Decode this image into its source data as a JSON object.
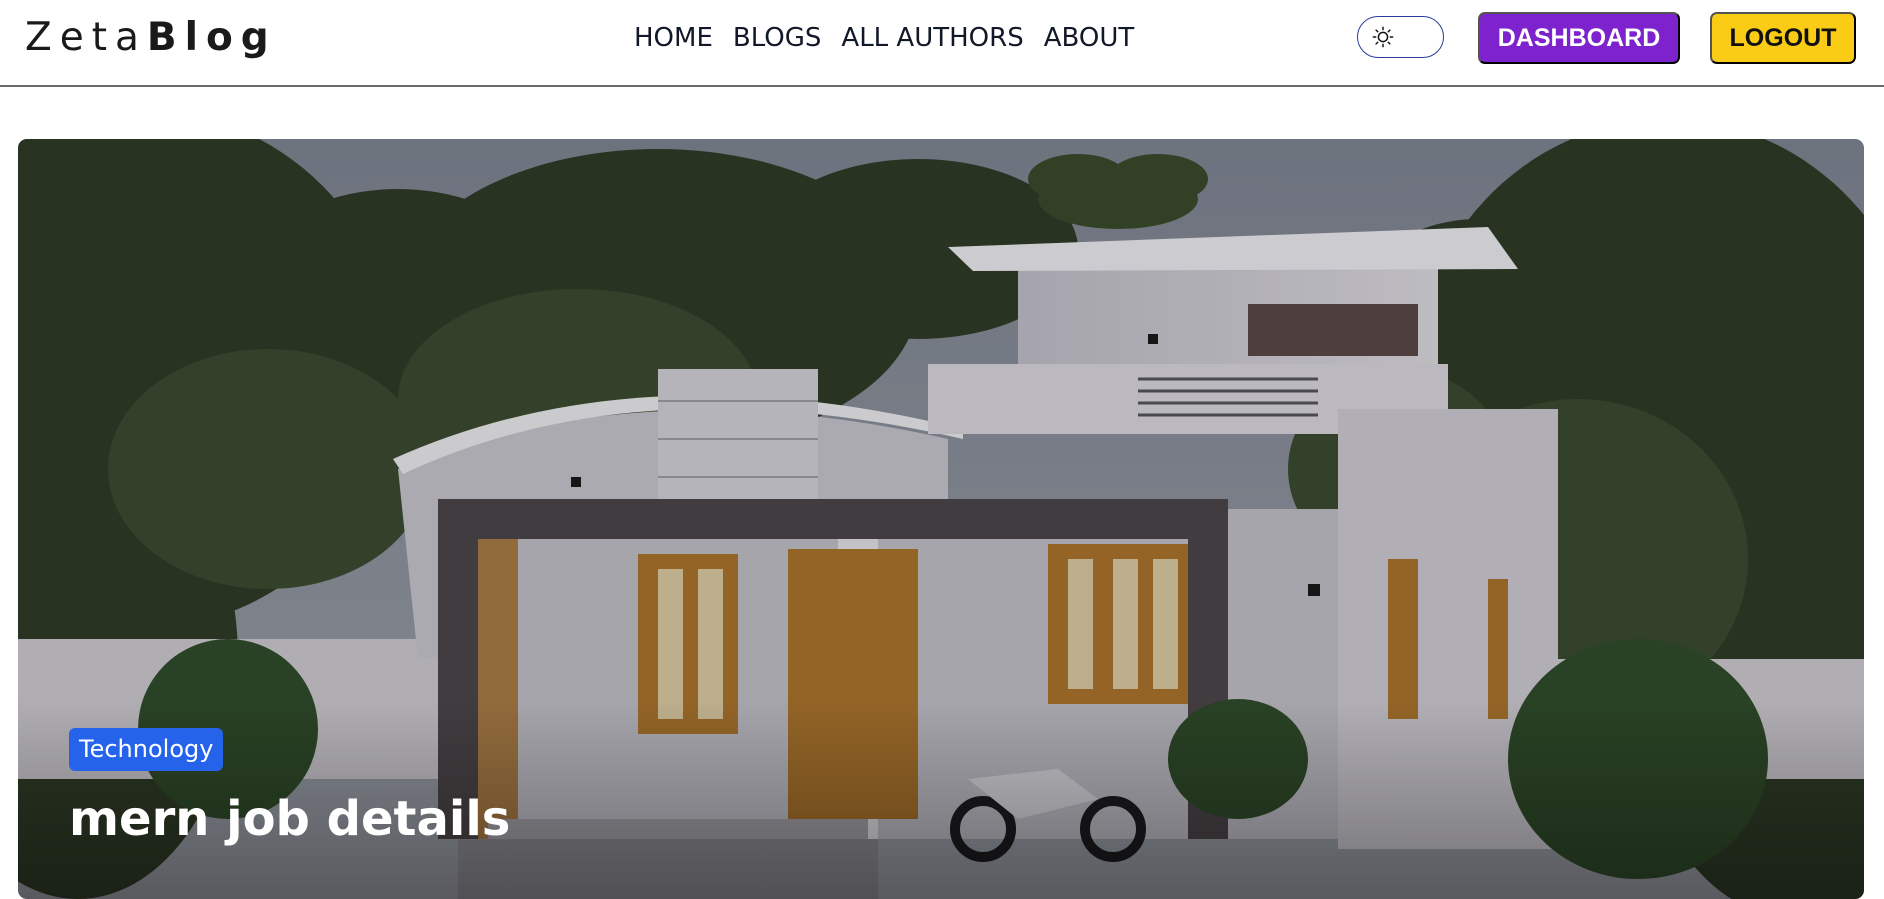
{
  "brand": {
    "part1": "Zeta",
    "part2": "Blog"
  },
  "nav": {
    "links": [
      "HOME",
      "BLOGS",
      "ALL AUTHORS",
      "ABOUT"
    ]
  },
  "theme_toggle": {
    "icon": "sun-icon"
  },
  "actions": {
    "dashboard": "DASHBOARD",
    "logout": "LOGOUT"
  },
  "hero": {
    "category": "Technology",
    "title": "mern job details",
    "image": "modern-house-photo"
  },
  "colors": {
    "dashboard_bg": "#7e22ce",
    "logout_bg": "#facc15",
    "badge_bg": "#2563eb",
    "toggle_border": "#2c3e9a"
  }
}
